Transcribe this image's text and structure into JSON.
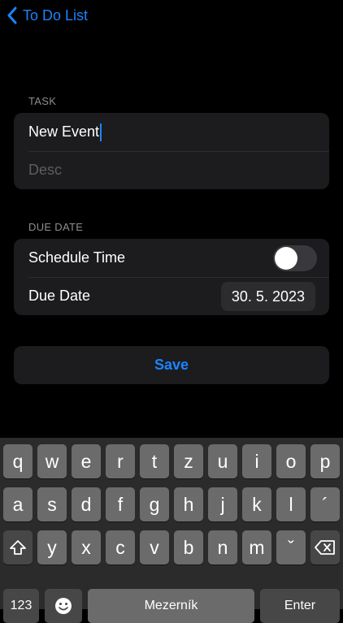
{
  "nav": {
    "back_label": "To Do List"
  },
  "task_section": {
    "header": "TASK",
    "title_value": "New Event",
    "desc_placeholder": "Desc"
  },
  "due_section": {
    "header": "DUE DATE",
    "schedule_label": "Schedule Time",
    "schedule_on": false,
    "due_label": "Due Date",
    "due_value": "30. 5. 2023"
  },
  "save_label": "Save",
  "keyboard": {
    "row1": [
      "q",
      "w",
      "e",
      "r",
      "t",
      "z",
      "u",
      "i",
      "o",
      "p"
    ],
    "row2": [
      "a",
      "s",
      "d",
      "f",
      "g",
      "h",
      "j",
      "k",
      "l",
      "´"
    ],
    "row3": [
      "y",
      "x",
      "c",
      "v",
      "b",
      "n",
      "m",
      "ˇ"
    ],
    "numbers_label": "123",
    "space_label": "Mezerník",
    "enter_label": "Enter"
  },
  "colors": {
    "accent": "#1a84ff",
    "group_bg": "#1c1c1e",
    "key": "#6b6b6b"
  }
}
